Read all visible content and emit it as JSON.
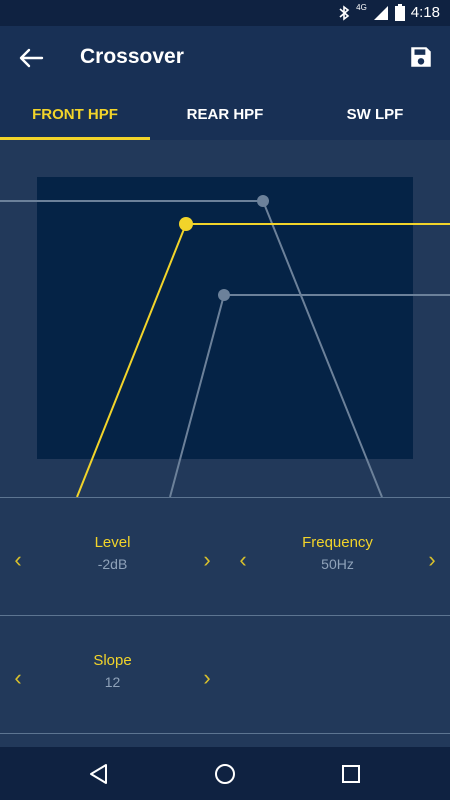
{
  "status_bar": {
    "time": "4:18",
    "icons": [
      "bluetooth-icon",
      "signal-4g-icon",
      "battery-icon"
    ],
    "network_label": "4G"
  },
  "app_bar": {
    "title": "Crossover",
    "back_icon": "arrow-left-icon",
    "save_icon": "save-icon"
  },
  "tabs": [
    {
      "label": "FRONT HPF",
      "active": true
    },
    {
      "label": "REAR HPF",
      "active": false
    },
    {
      "label": "SW LPF",
      "active": false
    }
  ],
  "controls": {
    "level": {
      "label": "Level",
      "value": "-2dB"
    },
    "frequency": {
      "label": "Frequency",
      "value": "50Hz"
    },
    "slope": {
      "label": "Slope",
      "value": "12"
    }
  },
  "colors": {
    "accent": "#f2d42a",
    "background": "#22395a",
    "app_bar": "#183055",
    "plot_area": "#052346",
    "inactive_curve": "#6c819a"
  },
  "nav_bar": {
    "icons": [
      "nav-back-icon",
      "nav-home-icon",
      "nav-recents-icon"
    ]
  }
}
